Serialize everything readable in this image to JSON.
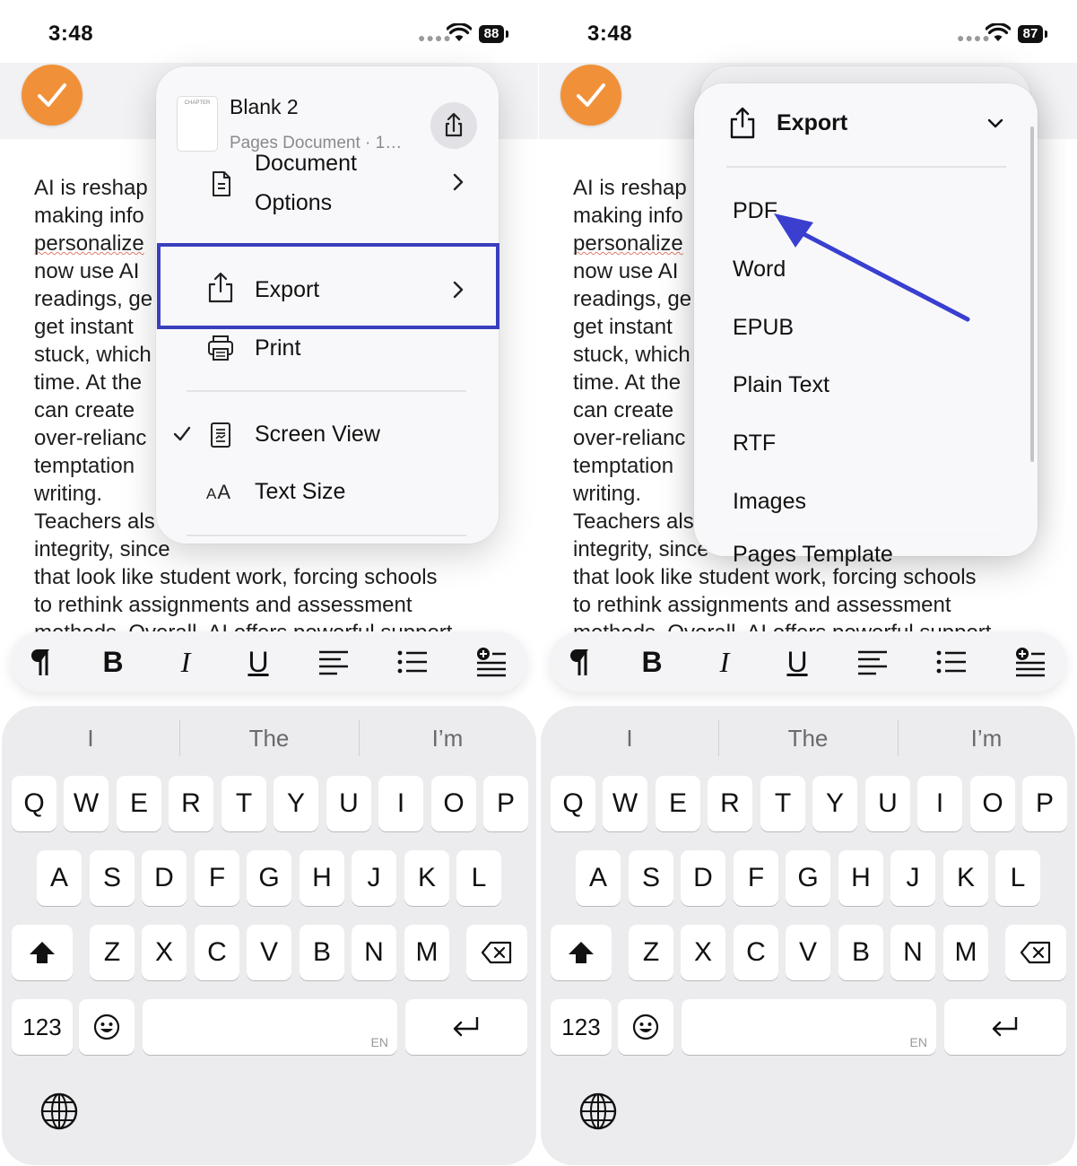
{
  "left": {
    "status": {
      "time": "3:48",
      "battery": "88"
    },
    "doc_lines": [
      "AI is reshap",
      "making info",
      "personalize",
      "now use AI",
      "readings, ge",
      "get instant",
      "stuck, which",
      "time. At the",
      "can create",
      "over-relianc",
      "temptation",
      "writing.",
      "Teachers als",
      "integrity, since",
      "that look like student work, forcing schools",
      "to rethink assignments and assessment",
      "methods. Overall, AI offers powerful support"
    ],
    "menu": {
      "doc_title": "Blank 2",
      "doc_subtitle": "Pages Document · 1…",
      "thumb_text": "CHAPTER",
      "items": {
        "document_options_1": "Document",
        "document_options_2": "Options",
        "export": "Export",
        "print": "Print",
        "screen_view": "Screen View",
        "text_size": "Text Size",
        "text_size_icon": "AA"
      }
    }
  },
  "right": {
    "status": {
      "time": "3:48",
      "battery": "87"
    },
    "doc_lines": [
      "AI is reshap",
      "making info",
      "personalize",
      "now use AI",
      "readings, ge",
      "get instant",
      "stuck, which",
      "time. At the",
      "can create",
      "over-relianc",
      "temptation",
      "writing.",
      "Teachers als",
      "integrity, since",
      "that look like student work, forcing schools",
      "to rethink assignments and assessment",
      "methods. Overall, AI offers powerful support"
    ],
    "export_menu": {
      "title": "Export",
      "options": [
        "PDF",
        "Word",
        "EPUB",
        "Plain Text",
        "RTF",
        "Images",
        "Pages Template"
      ]
    }
  },
  "toolbar": {
    "bold": "B",
    "italic": "I",
    "underline": "U"
  },
  "keyboard": {
    "suggestions": [
      "I",
      "The",
      "I’m"
    ],
    "row1": [
      "Q",
      "W",
      "E",
      "R",
      "T",
      "Y",
      "U",
      "I",
      "O",
      "P"
    ],
    "row2": [
      "A",
      "S",
      "D",
      "F",
      "G",
      "H",
      "J",
      "K",
      "L"
    ],
    "row3": [
      "Z",
      "X",
      "C",
      "V",
      "B",
      "N",
      "M"
    ],
    "numbers_key": "123",
    "space_lang": "EN"
  },
  "colors": {
    "accent_orange": "#f0913a",
    "highlight_blue": "#3a3fbd",
    "arrow_blue": "#3a3fd0"
  },
  "icons": [
    "wifi-icon",
    "checkmark-icon",
    "share-icon",
    "document-icon",
    "export-icon",
    "print-icon",
    "screen-view-icon",
    "chevron-right-icon",
    "chevron-down-icon",
    "paragraph-icon",
    "align-left-icon",
    "bullet-list-icon",
    "insert-icon",
    "shift-icon",
    "delete-icon",
    "emoji-icon",
    "return-icon",
    "globe-icon"
  ]
}
